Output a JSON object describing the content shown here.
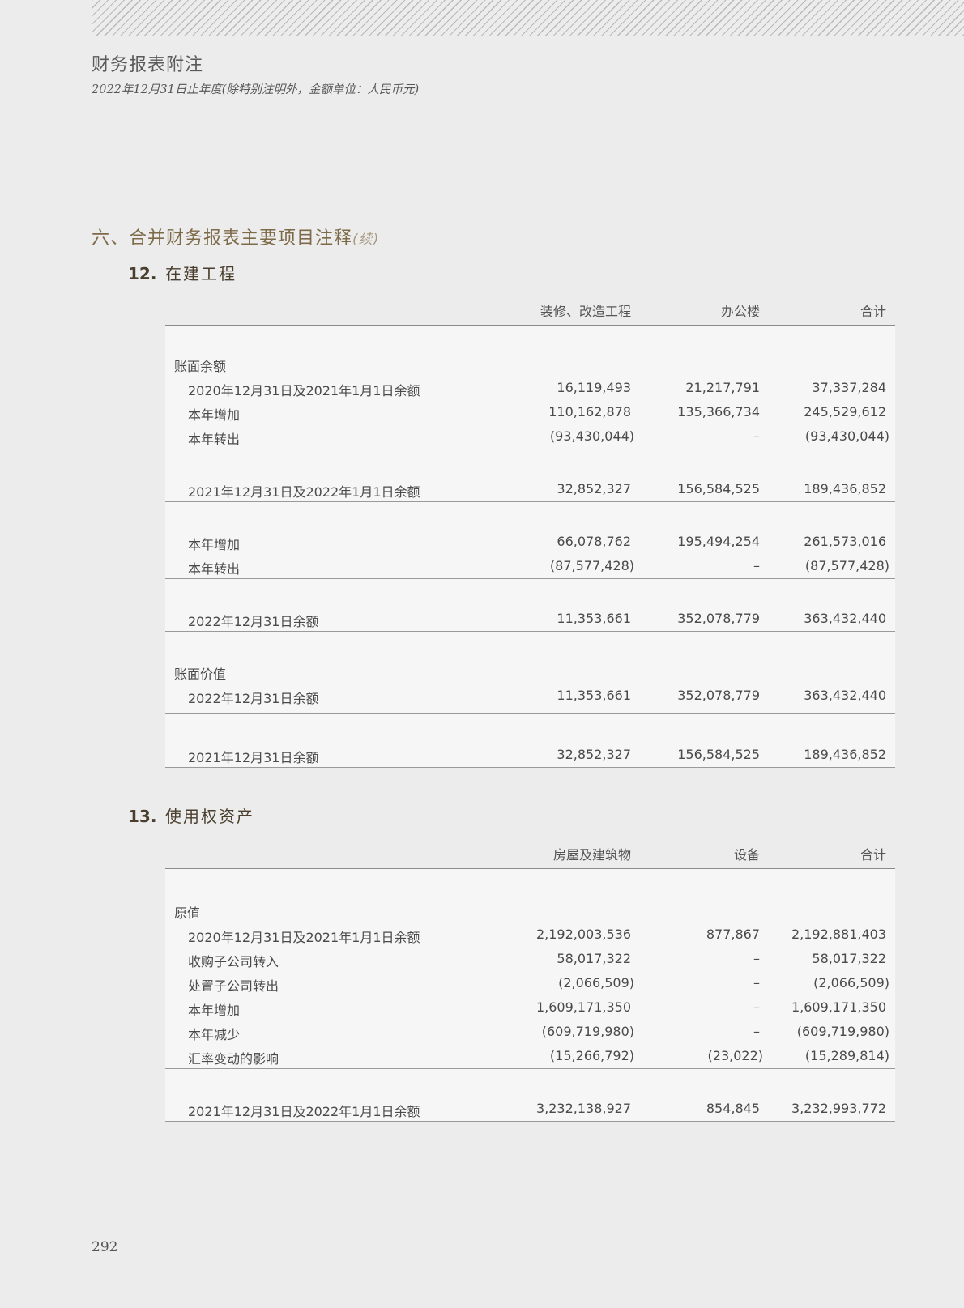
{
  "header": {
    "title": "财务报表附注",
    "subtitle": "2022年12月31日止年度(除特别注明外，金额单位：人民币元)"
  },
  "section": {
    "title": "六、合并财务报表主要项目注释",
    "continued": "(续)"
  },
  "note12": {
    "number": "12.",
    "title": "在建工程",
    "columns": [
      "装修、改造工程",
      "办公楼",
      "合计"
    ],
    "group1_label": "账面余额",
    "group1_rows": [
      {
        "label": "2020年12月31日及2021年1月1日余额",
        "v1": "16,119,493",
        "v2": "21,217,791",
        "v3": "37,337,284"
      },
      {
        "label": "本年增加",
        "v1": "110,162,878",
        "v2": "135,366,734",
        "v3": "245,529,612"
      },
      {
        "label": "本年转出",
        "v1": "(93,430,044)",
        "v2": "–",
        "v3": "(93,430,044)"
      }
    ],
    "bal2021": {
      "label": "2021年12月31日及2022年1月1日余额",
      "v1": "32,852,327",
      "v2": "156,584,525",
      "v3": "189,436,852"
    },
    "rows2022": [
      {
        "label": "本年增加",
        "v1": "66,078,762",
        "v2": "195,494,254",
        "v3": "261,573,016"
      },
      {
        "label": "本年转出",
        "v1": "(87,577,428)",
        "v2": "–",
        "v3": "(87,577,428)"
      }
    ],
    "bal2022": {
      "label": "2022年12月31日余额",
      "v1": "11,353,661",
      "v2": "352,078,779",
      "v3": "363,432,440"
    },
    "group2_label": "账面价值",
    "bv2022": {
      "label": "2022年12月31日余额",
      "v1": "11,353,661",
      "v2": "352,078,779",
      "v3": "363,432,440"
    },
    "bv2021": {
      "label": "2021年12月31日余额",
      "v1": "32,852,327",
      "v2": "156,584,525",
      "v3": "189,436,852"
    }
  },
  "note13": {
    "number": "13.",
    "title": "使用权资产",
    "columns": [
      "房屋及建筑物",
      "设备",
      "合计"
    ],
    "group1_label": "原值",
    "rows": [
      {
        "label": "2020年12月31日及2021年1月1日余额",
        "v1": "2,192,003,536",
        "v2": "877,867",
        "v3": "2,192,881,403"
      },
      {
        "label": "收购子公司转入",
        "v1": "58,017,322",
        "v2": "–",
        "v3": "58,017,322"
      },
      {
        "label": "处置子公司转出",
        "v1": "(2,066,509)",
        "v2": "–",
        "v3": "(2,066,509)"
      },
      {
        "label": "本年增加",
        "v1": "1,609,171,350",
        "v2": "–",
        "v3": "1,609,171,350"
      },
      {
        "label": "本年减少",
        "v1": "(609,719,980)",
        "v2": "–",
        "v3": "(609,719,980)"
      },
      {
        "label": "汇率变动的影响",
        "v1": "(15,266,792)",
        "v2": "(23,022)",
        "v3": "(15,289,814)"
      }
    ],
    "bal2021": {
      "label": "2021年12月31日及2022年1月1日余额",
      "v1": "3,232,138,927",
      "v2": "854,845",
      "v3": "3,232,993,772"
    }
  },
  "page_number": "292"
}
